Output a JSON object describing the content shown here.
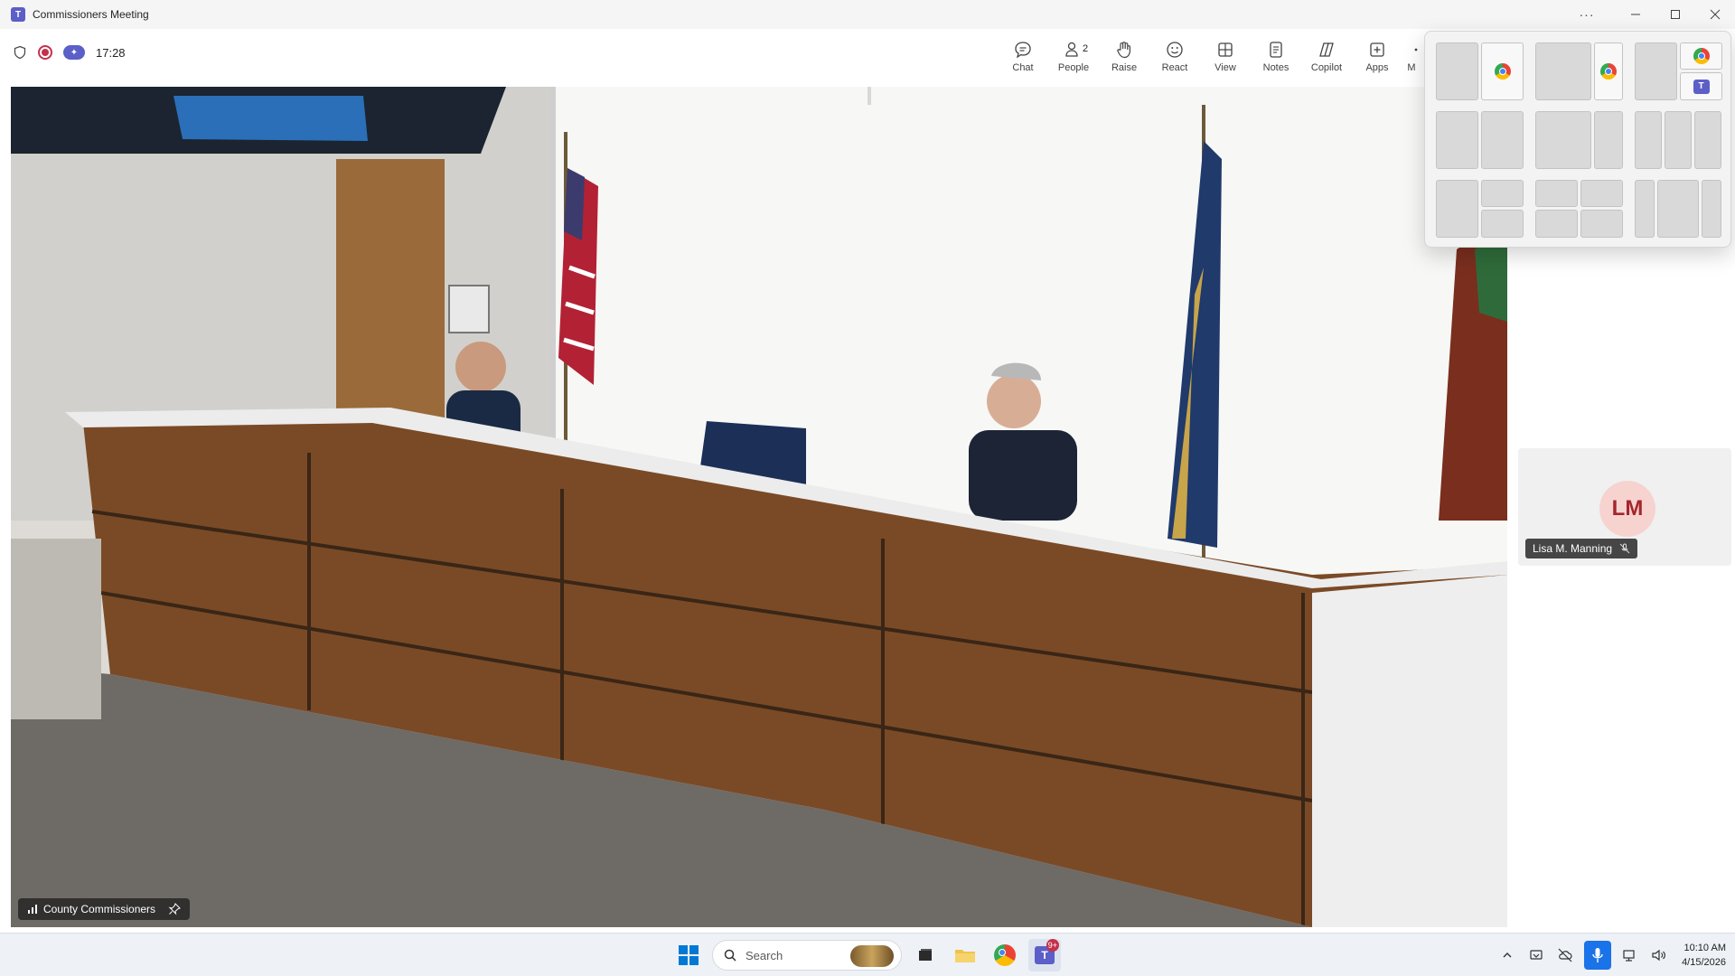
{
  "window": {
    "title": "Commissioners Meeting",
    "more_label": "···"
  },
  "meeting": {
    "elapsed": "17:28",
    "toolbar": [
      {
        "id": "chat",
        "label": "Chat",
        "icon": "chat-icon"
      },
      {
        "id": "people",
        "label": "People",
        "icon": "people-icon",
        "count": "2"
      },
      {
        "id": "raise",
        "label": "Raise",
        "icon": "hand-icon"
      },
      {
        "id": "react",
        "label": "React",
        "icon": "smile-icon"
      },
      {
        "id": "view",
        "label": "View",
        "icon": "grid-icon"
      },
      {
        "id": "notes",
        "label": "Notes",
        "icon": "notes-icon"
      },
      {
        "id": "copilot",
        "label": "Copilot",
        "icon": "copilot-icon"
      },
      {
        "id": "apps",
        "label": "Apps",
        "icon": "plus-box-icon"
      },
      {
        "id": "more",
        "label": "M",
        "icon": "more-icon"
      }
    ]
  },
  "stage": {
    "participant_label": "County Commissioners"
  },
  "side_panel": {
    "participant": {
      "initials": "LM",
      "name": "Lisa M. Manning",
      "avatar_bg": "#f6d3cf",
      "avatar_fg": "#a4262c"
    }
  },
  "snap_flyout": {
    "apps_shown": [
      "chrome",
      "chrome",
      "chrome",
      "teams"
    ]
  },
  "taskbar": {
    "search_placeholder": "Search",
    "teams_badge": "9+",
    "time": "10:10 AM",
    "date": "4/15/2026",
    "accent": "#0078d4"
  }
}
